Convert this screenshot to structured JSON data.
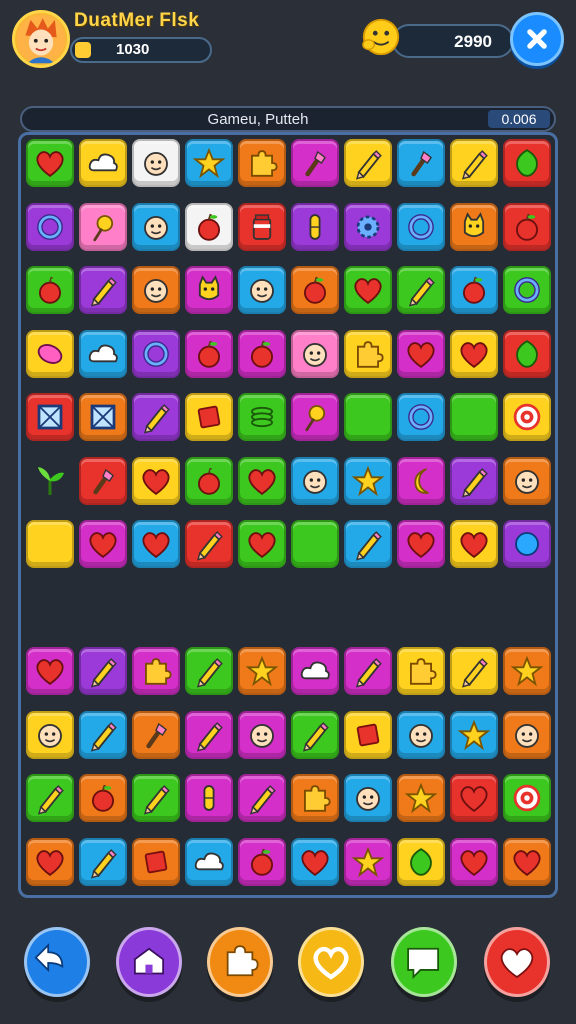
{
  "hud": {
    "player_name": "DuatMer Flsk",
    "xp_value": "1030",
    "xp_progress": 0.12,
    "coins": "2990"
  },
  "board_header": {
    "title": "Gameu, Putteh",
    "score": "0.006"
  },
  "palette": {
    "red": "#e8322c",
    "orange": "#f07a1a",
    "yellow": "#ffd21f",
    "green": "#3cc81e",
    "cyan": "#24a9e8",
    "blue": "#2a6be0",
    "purple": "#9b3ad8",
    "magenta": "#d42fc8",
    "pink": "#ff7fc8",
    "white": "#f4f4f4",
    "empty": "#262c36"
  },
  "board": {
    "rows": [
      [
        [
          "green",
          "heart"
        ],
        [
          "yellow",
          "cloud"
        ],
        [
          "white",
          "face"
        ],
        [
          "cyan",
          "star"
        ],
        [
          "orange",
          "puzzle"
        ],
        [
          "magenta",
          "brush"
        ],
        [
          "yellow",
          "pencil"
        ],
        [
          "cyan",
          "brush"
        ],
        [
          "yellow",
          "pencil"
        ],
        [
          "red",
          "leaf"
        ]
      ],
      [
        [
          "purple",
          "ring"
        ],
        [
          "pink",
          "lollipop"
        ],
        [
          "cyan",
          "face"
        ],
        [
          "white",
          "apple"
        ],
        [
          "red",
          "jar"
        ],
        [
          "purple",
          "pill"
        ],
        [
          "purple",
          "gear"
        ],
        [
          "cyan",
          "ring"
        ],
        [
          "orange",
          "cat"
        ],
        [
          "red",
          "apple"
        ]
      ],
      [
        [
          "green",
          "apple"
        ],
        [
          "purple",
          "pencil"
        ],
        [
          "orange",
          "face"
        ],
        [
          "magenta",
          "cat"
        ],
        [
          "cyan",
          "face"
        ],
        [
          "orange",
          "apple"
        ],
        [
          "green",
          "heart"
        ],
        [
          "green",
          "pencil"
        ],
        [
          "cyan",
          "apple"
        ],
        [
          "green",
          "ring"
        ]
      ],
      [
        [
          "yellow",
          "bean"
        ],
        [
          "cyan",
          "cloud"
        ],
        [
          "purple",
          "ring"
        ],
        [
          "magenta",
          "apple"
        ],
        [
          "magenta",
          "apple"
        ],
        [
          "pink",
          "face"
        ],
        [
          "yellow",
          "puzzle"
        ],
        [
          "magenta",
          "heart"
        ],
        [
          "yellow",
          "heart"
        ],
        [
          "red",
          "leaf"
        ]
      ],
      [
        [
          "red",
          "frame"
        ],
        [
          "orange",
          "frame"
        ],
        [
          "purple",
          "pencil"
        ],
        [
          "yellow",
          "square"
        ],
        [
          "green",
          "coin"
        ],
        [
          "magenta",
          "lollipop"
        ],
        [
          "green",
          "blank"
        ],
        [
          "cyan",
          "ring"
        ],
        [
          "green",
          "blank"
        ],
        [
          "yellow",
          "target"
        ]
      ],
      [
        [
          "empty",
          "sprout"
        ],
        [
          "red",
          "brush"
        ],
        [
          "yellow",
          "heart"
        ],
        [
          "green",
          "apple"
        ],
        [
          "green",
          "heart"
        ],
        [
          "cyan",
          "face"
        ],
        [
          "cyan",
          "star"
        ],
        [
          "magenta",
          "moon"
        ],
        [
          "purple",
          "pencil"
        ],
        [
          "orange",
          "face"
        ]
      ],
      [
        [
          "yellow",
          "blank"
        ],
        [
          "magenta",
          "heart"
        ],
        [
          "cyan",
          "heart"
        ],
        [
          "red",
          "pencil"
        ],
        [
          "green",
          "heart"
        ],
        [
          "green",
          "blank"
        ],
        [
          "cyan",
          "pencil"
        ],
        [
          "magenta",
          "heart"
        ],
        [
          "yellow",
          "heart"
        ],
        [
          "purple",
          "bubble"
        ]
      ],
      [
        [
          "empty",
          "blank"
        ],
        [
          "empty",
          "blank"
        ],
        [
          "empty",
          "blank"
        ],
        [
          "empty",
          "blank"
        ],
        [
          "empty",
          "blank"
        ],
        [
          "empty",
          "blank"
        ],
        [
          "empty",
          "blank"
        ],
        [
          "empty",
          "blank"
        ],
        [
          "empty",
          "blank"
        ],
        [
          "empty",
          "blank"
        ]
      ],
      [
        [
          "magenta",
          "heart"
        ],
        [
          "purple",
          "pencil"
        ],
        [
          "magenta",
          "puzzle"
        ],
        [
          "green",
          "pencil"
        ],
        [
          "orange",
          "star"
        ],
        [
          "magenta",
          "cloud"
        ],
        [
          "magenta",
          "pencil"
        ],
        [
          "yellow",
          "puzzle"
        ],
        [
          "yellow",
          "pencil"
        ],
        [
          "orange",
          "star"
        ]
      ],
      [
        [
          "yellow",
          "face"
        ],
        [
          "cyan",
          "pencil"
        ],
        [
          "orange",
          "brush"
        ],
        [
          "magenta",
          "pencil"
        ],
        [
          "magenta",
          "face"
        ],
        [
          "green",
          "pencil"
        ],
        [
          "yellow",
          "square"
        ],
        [
          "cyan",
          "face"
        ],
        [
          "cyan",
          "star"
        ],
        [
          "orange",
          "face"
        ]
      ],
      [
        [
          "green",
          "pencil"
        ],
        [
          "orange",
          "apple"
        ],
        [
          "green",
          "pencil"
        ],
        [
          "magenta",
          "pill"
        ],
        [
          "magenta",
          "pencil"
        ],
        [
          "orange",
          "puzzle"
        ],
        [
          "cyan",
          "face"
        ],
        [
          "orange",
          "star"
        ],
        [
          "red",
          "heart"
        ],
        [
          "green",
          "target"
        ]
      ],
      [
        [
          "orange",
          "heart"
        ],
        [
          "cyan",
          "pencil"
        ],
        [
          "orange",
          "square"
        ],
        [
          "cyan",
          "cloud"
        ],
        [
          "magenta",
          "apple"
        ],
        [
          "cyan",
          "heart"
        ],
        [
          "magenta",
          "star"
        ],
        [
          "yellow",
          "leaf"
        ],
        [
          "magenta",
          "heart"
        ],
        [
          "orange",
          "heart"
        ]
      ],
      [
        [
          "cyan",
          "apple"
        ],
        [
          "magenta",
          "pencil"
        ],
        [
          "orange",
          "coin"
        ],
        [
          "cyan",
          "bean"
        ],
        [
          "orange",
          "face"
        ],
        [
          "yellow",
          "square"
        ],
        [
          "yellow",
          "apple"
        ],
        [
          "red",
          "pencil"
        ],
        [
          "cyan",
          "frame"
        ],
        [
          "red",
          "ring"
        ]
      ]
    ]
  },
  "bottom_bar": [
    {
      "name": "back-button",
      "color": "#1e7fe6",
      "icon": "back-arrow-icon"
    },
    {
      "name": "home-button",
      "color": "#8a3ad8",
      "icon": "home-icon"
    },
    {
      "name": "hint-button",
      "color": "#f08a12",
      "icon": "puzzle-piece-icon"
    },
    {
      "name": "favorite-button",
      "color": "#f5b814",
      "icon": "heart-outline-icon"
    },
    {
      "name": "chat-button",
      "color": "#3cc81e",
      "icon": "chat-bubble-icon"
    },
    {
      "name": "like-button",
      "color": "#e8322c",
      "icon": "heart-icon"
    }
  ]
}
